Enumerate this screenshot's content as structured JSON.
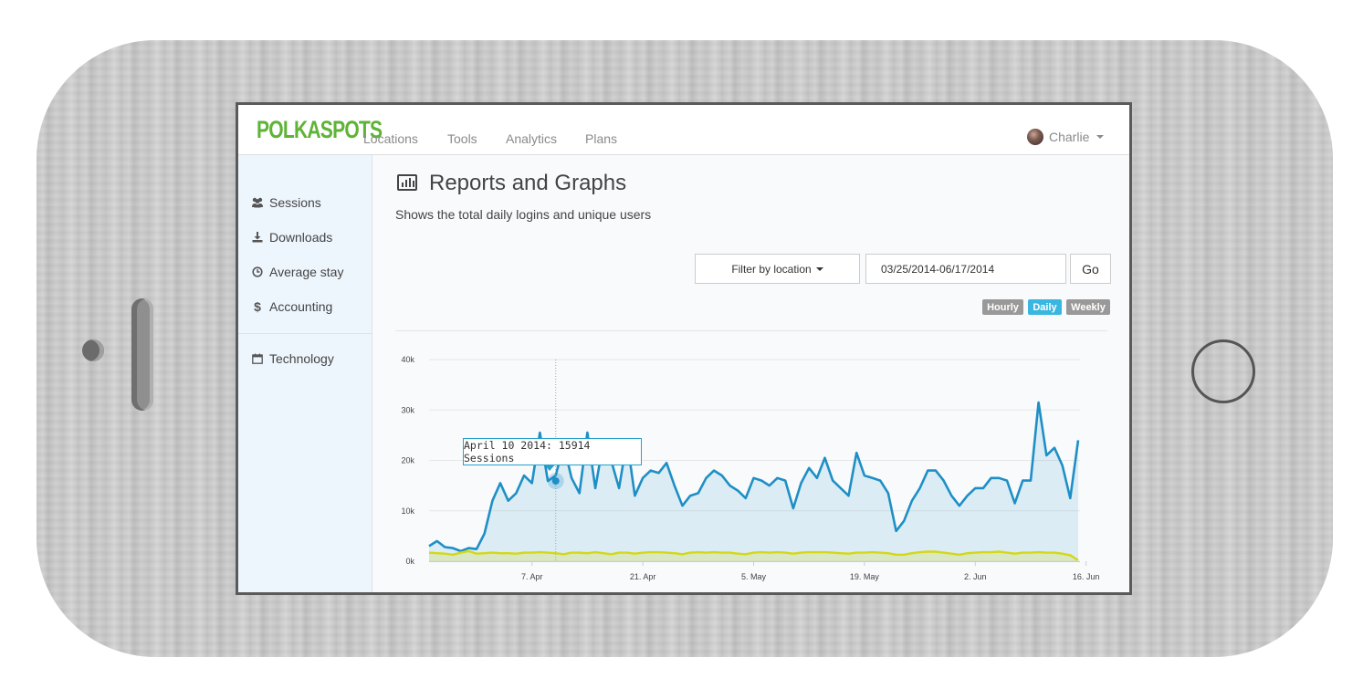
{
  "app": {
    "brand": "POLKASPOTS"
  },
  "nav": {
    "items": [
      "Locations",
      "Tools",
      "Analytics",
      "Plans"
    ],
    "user": "Charlie"
  },
  "sidebar": {
    "items": [
      {
        "label": "Sessions",
        "icon": "users-icon"
      },
      {
        "label": "Downloads",
        "icon": "download-icon"
      },
      {
        "label": "Average stay",
        "icon": "clock-icon"
      },
      {
        "label": "Accounting",
        "icon": "dollar-icon"
      }
    ],
    "items2": [
      {
        "label": "Technology",
        "icon": "calendar-icon"
      }
    ]
  },
  "page": {
    "title": "Reports and Graphs",
    "subtitle": "Shows the total daily logins and unique users"
  },
  "controls": {
    "filter_label": "Filter by location",
    "date_range": "03/25/2014-06/17/2014",
    "go_label": "Go",
    "granularity": [
      {
        "label": "Hourly",
        "active": false
      },
      {
        "label": "Daily",
        "active": true
      },
      {
        "label": "Weekly",
        "active": false
      }
    ]
  },
  "colors": {
    "brand": "#5fb336",
    "sessions": "#1e8fc6",
    "users": "#d4d816",
    "active": "#3ab7e0",
    "inactive": "#999999"
  },
  "chart_data": {
    "type": "line",
    "x_start": "2014-03-25",
    "x_end": "2014-06-17",
    "x_ticks": [
      "7. Apr",
      "21. Apr",
      "5. May",
      "19. May",
      "2. Jun",
      "16. Jun"
    ],
    "y_ticks": [
      "0k",
      "10k",
      "20k",
      "30k",
      "40k"
    ],
    "ylim": [
      0,
      40000
    ],
    "grid": true,
    "tooltip": "April 10 2014: 15914 Sessions",
    "series": [
      {
        "name": "Sessions",
        "values": [
          3000,
          4000,
          2800,
          2600,
          2000,
          2600,
          2400,
          5500,
          12000,
          15500,
          12000,
          13500,
          17000,
          15500,
          25500,
          15914,
          17000,
          23000,
          16500,
          13500,
          25500,
          14500,
          23500,
          20000,
          14500,
          24000,
          13000,
          16500,
          18000,
          17500,
          19500,
          15000,
          11000,
          13000,
          13500,
          16500,
          18000,
          17000,
          15000,
          14000,
          12500,
          16500,
          16000,
          15000,
          16500,
          16000,
          10500,
          15500,
          18500,
          16500,
          20500,
          16000,
          14500,
          13000,
          21500,
          17000,
          16500,
          16000,
          13500,
          6000,
          8000,
          12000,
          14500,
          18000,
          18000,
          16000,
          13000,
          11000,
          13000,
          14500,
          14500,
          16500,
          16500,
          16000,
          11500,
          16000,
          16000,
          31500,
          21000,
          22500,
          19000,
          12500,
          24000
        ],
        "last_label": ""
      },
      {
        "name": "Unique users",
        "values": [
          1700,
          1600,
          1500,
          1300,
          1700,
          2000,
          1500,
          1600,
          1700,
          1600,
          1600,
          1500,
          1700,
          1700,
          1800,
          1700,
          1600,
          1400,
          1700,
          1700,
          1600,
          1800,
          1600,
          1400,
          1700,
          1700,
          1500,
          1700,
          1800,
          1800,
          1700,
          1600,
          1400,
          1700,
          1800,
          1700,
          1800,
          1700,
          1700,
          1500,
          1400,
          1700,
          1800,
          1700,
          1800,
          1700,
          1500,
          1700,
          1800,
          1800,
          1800,
          1700,
          1600,
          1500,
          1700,
          1700,
          1800,
          1700,
          1600,
          1300,
          1300,
          1600,
          1800,
          1900,
          1900,
          1700,
          1500,
          1300,
          1600,
          1700,
          1800,
          1800,
          1900,
          1700,
          1500,
          1700,
          1700,
          1800,
          1700,
          1700,
          1500,
          1200,
          200
        ]
      }
    ]
  }
}
